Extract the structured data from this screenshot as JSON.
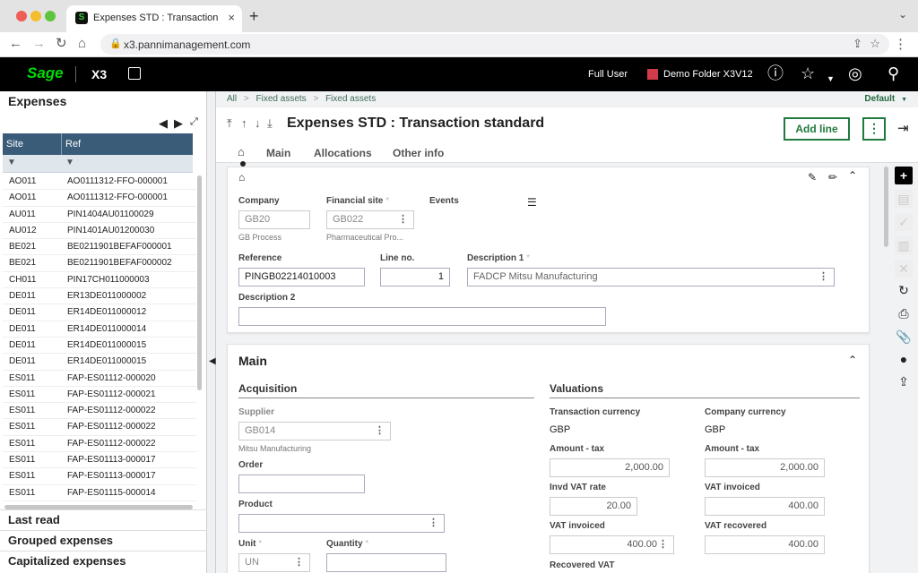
{
  "browser": {
    "tab_title": "Expenses STD : Transaction sta",
    "tab_icon": "S",
    "url": "x3.pannimanagement.com",
    "new_tab": "+"
  },
  "header": {
    "logo": "Sage",
    "app": "X3",
    "user": "Full User",
    "folder": "Demo Folder X3V12",
    "folder_color": "#d33a4a",
    "icons": [
      "help-icon",
      "star-icon",
      "compass-icon",
      "search-icon"
    ]
  },
  "left": {
    "title": "Expenses",
    "columns": [
      "Site",
      "Ref"
    ],
    "rows": [
      [
        "AO011",
        "AO0111312-FFO-000001"
      ],
      [
        "AO011",
        "AO0111312-FFO-000001"
      ],
      [
        "AU011",
        "PIN1404AU01100029"
      ],
      [
        "AU012",
        "PIN1401AU01200030"
      ],
      [
        "BE021",
        "BE0211901BEFAF000001"
      ],
      [
        "BE021",
        "BE0211901BEFAF000002"
      ],
      [
        "CH011",
        "PIN17CH011000003"
      ],
      [
        "DE011",
        "ER13DE011000002"
      ],
      [
        "DE011",
        "ER14DE011000012"
      ],
      [
        "DE011",
        "ER14DE011000014"
      ],
      [
        "DE011",
        "ER14DE011000015"
      ],
      [
        "DE011",
        "ER14DE011000015"
      ],
      [
        "ES011",
        "FAP-ES01112-000020"
      ],
      [
        "ES011",
        "FAP-ES01112-000021"
      ],
      [
        "ES011",
        "FAP-ES01112-000022"
      ],
      [
        "ES011",
        "FAP-ES01112-000022"
      ],
      [
        "ES011",
        "FAP-ES01112-000022"
      ],
      [
        "ES011",
        "FAP-ES01113-000017"
      ],
      [
        "ES011",
        "FAP-ES01113-000017"
      ],
      [
        "ES011",
        "FAP-ES01115-000014"
      ]
    ],
    "sections": [
      "Last read",
      "Grouped expenses",
      "Capitalized expenses"
    ]
  },
  "breadcrumb": [
    "All",
    "Fixed assets",
    "Fixed assets"
  ],
  "breadcrumb_sep": ">",
  "view": "Default",
  "title": "Expenses STD : Transaction standard",
  "add_line": "Add line",
  "tabs": [
    "Main",
    "Allocations",
    "Other info"
  ],
  "form": {
    "company_label": "Company",
    "company": "GB20",
    "company_desc": "GB Process",
    "fin_site_label": "Financial site",
    "fin_site": "GB022",
    "fin_site_desc": "Pharmaceutical Pro...",
    "events_label": "Events",
    "reference_label": "Reference",
    "reference": "PINGB02214010003",
    "line_no_label": "Line no.",
    "line_no": "1",
    "description1_label": "Description 1",
    "description1": "FADCP Mitsu Manufacturing",
    "description2_label": "Description 2",
    "description2": ""
  },
  "main_section": {
    "title": "Main",
    "acquisition": "Acquisition",
    "valuations": "Valuations",
    "supplier_label": "Supplier",
    "supplier": "GB014",
    "supplier_desc": "Mitsu Manufacturing",
    "order_label": "Order",
    "product_label": "Product",
    "unit_label": "Unit",
    "unit": "UN",
    "quantity_label": "Quantity",
    "trans_currency_label": "Transaction currency",
    "trans_currency": "GBP",
    "comp_currency_label": "Company currency",
    "comp_currency": "GBP",
    "amount_tax_label": "Amount - tax",
    "amount_tax_trans": "2,000.00",
    "amount_tax_comp": "2,000.00",
    "invd_vat_rate_label": "Invd VAT rate",
    "invd_vat_rate": "20.00",
    "vat_invoiced_label": "VAT invoiced",
    "vat_invoiced_comp": "400.00",
    "vat_invoiced_trans": "400.00",
    "vat_recovered_label": "VAT recovered",
    "vat_recovered": "400.00",
    "recovered_vat_label": "Recovered VAT"
  }
}
